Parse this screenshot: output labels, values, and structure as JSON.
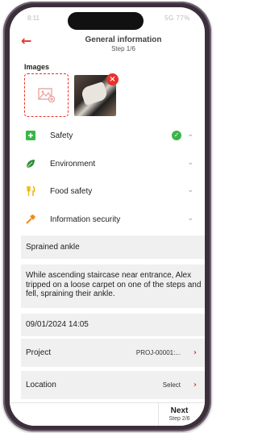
{
  "status_bar": {
    "time": "8:11",
    "right": "5G 77%"
  },
  "header": {
    "title": "General information",
    "step": "Step 1/6"
  },
  "images": {
    "label": "Images"
  },
  "categories": [
    {
      "label": "Safety",
      "icon": "plus-square-icon",
      "color": "#3cb54a",
      "completed": true
    },
    {
      "label": "Environment",
      "icon": "leaf-icon",
      "color": "#2f8f3a",
      "completed": false
    },
    {
      "label": "Food safety",
      "icon": "cutlery-icon",
      "color": "#f2b200",
      "completed": false
    },
    {
      "label": "Information security",
      "icon": "hammer-icon",
      "color": "#f08a1c",
      "completed": false
    }
  ],
  "form": {
    "title_value": "Sprained ankle",
    "description_value": "While ascending staircase near entrance, Alex tripped on a loose carpet on one of the steps and fell, spraining their ankle.",
    "datetime_value": "09/01/2024 14:05",
    "project_label": "Project",
    "project_value": "PROJ-00001:...",
    "location_label": "Location",
    "location_value": "Select"
  },
  "footer": {
    "next_label": "Next",
    "next_step": "Step 2/6"
  },
  "colors": {
    "accent": "#e8322b",
    "success": "#3cb54a",
    "field_bg": "#f0f0f0"
  }
}
